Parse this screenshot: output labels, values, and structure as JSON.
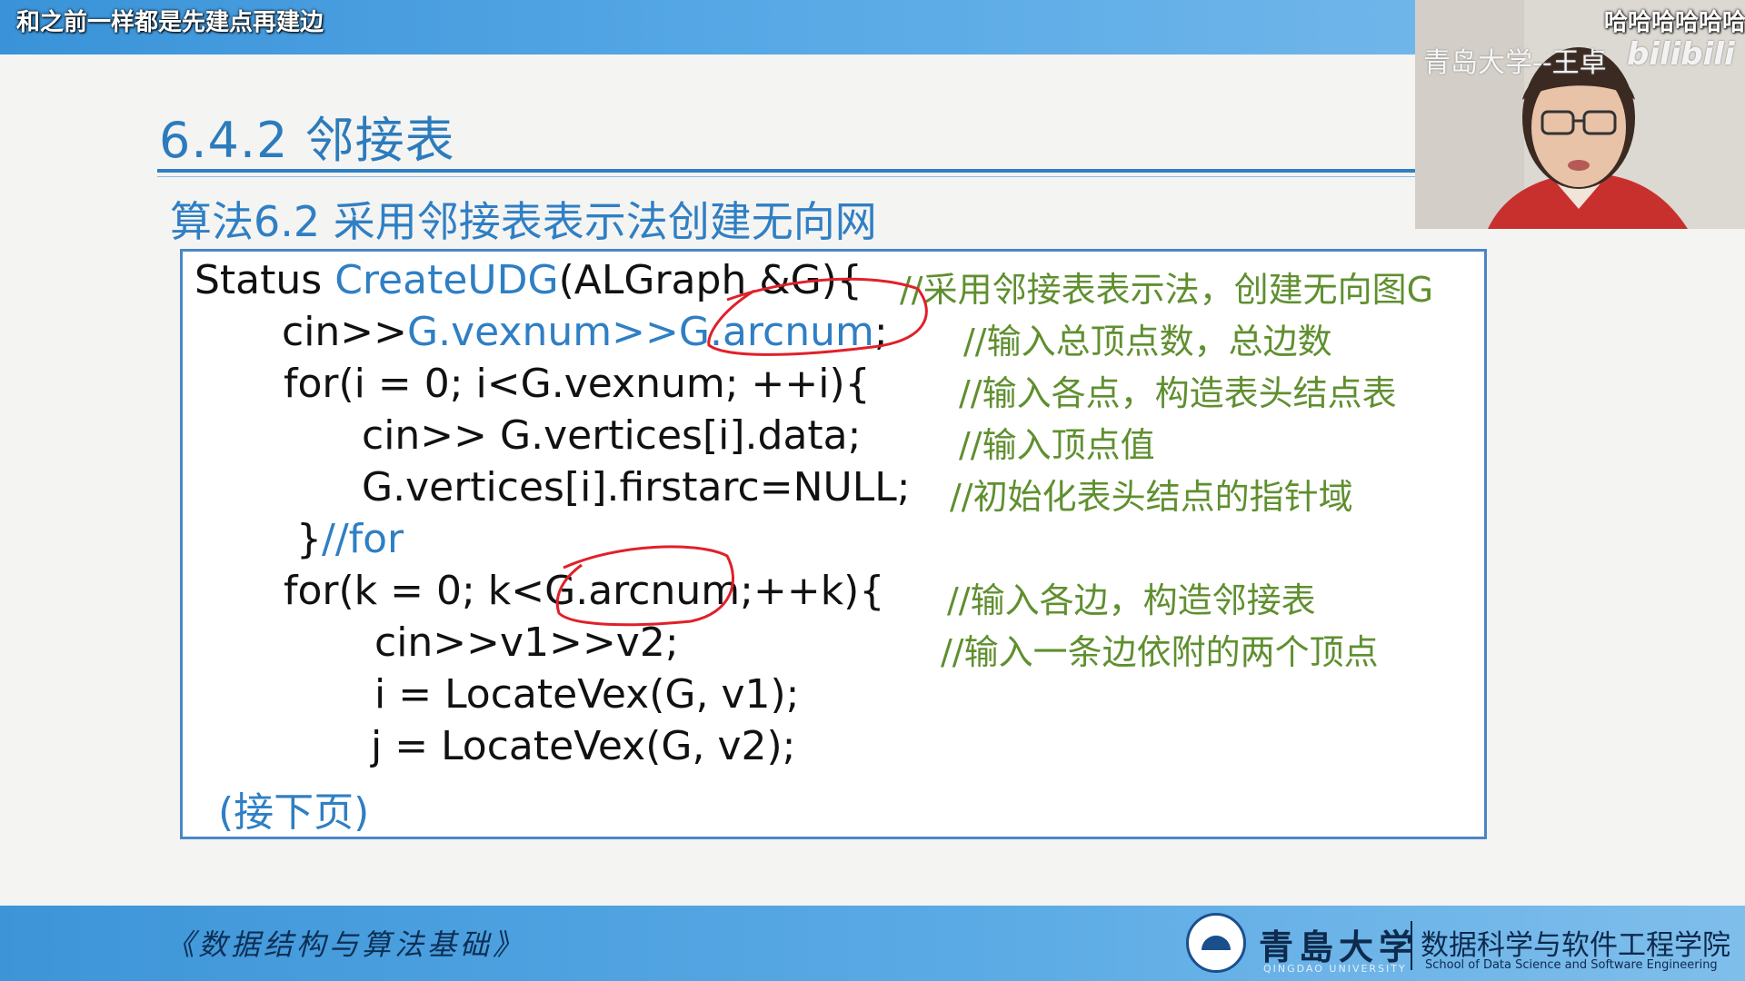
{
  "danmaku": {
    "left": "和之前一样都是先建点再建边",
    "right": "哈哈哈哈哈哈"
  },
  "webcam": {
    "watermark": "青岛大学--王卓",
    "platform": "bilibili"
  },
  "slide": {
    "title": "6.4.2 邻接表",
    "subtitle": "算法6.2 采用邻接表表示法创建无向网",
    "code_lines": [
      {
        "pre": "Status ",
        "blue": "CreateUDG",
        "post": "(ALGraph &G){"
      },
      {
        "pre": "cin>>",
        "blue": "G.vexnum>>G.arcnum",
        "post": ";"
      },
      {
        "text": "for(i = 0; i<G.vexnum; ++i){"
      },
      {
        "text": "cin>> G.vertices[i].data;"
      },
      {
        "text": "G.vertices[i].firstarc=NULL;"
      },
      {
        "pre": "}",
        "blue": "//for",
        "post": ""
      },
      {
        "text": "for(k = 0; k<G.arcnum;++k){"
      },
      {
        "text": "cin>>v1>>v2;"
      },
      {
        "text": "i = LocateVex(G, v1);"
      },
      {
        "text": "j = LocateVex(G, v2);"
      }
    ],
    "comments": [
      "//采用邻接表表示法，创建无向图G",
      "//输入总顶点数，总边数",
      "//输入各点，构造表头结点表",
      "//输入顶点值",
      "//初始化表头结点的指针域",
      "//输入各边，构造邻接表",
      "//输入一条边依附的两个顶点"
    ],
    "continue_label": "(接下页)"
  },
  "footer": {
    "course": "《数据结构与算法基础》",
    "university": "青島大学",
    "university_en": "QINGDAO UNIVERSITY",
    "school": "数据科学与软件工程学院",
    "school_en": "School of Data Science and Software Engineering"
  },
  "colors": {
    "accent": "#2f7fc4",
    "comment": "#5f8f2f",
    "annotation": "#e0202a"
  }
}
